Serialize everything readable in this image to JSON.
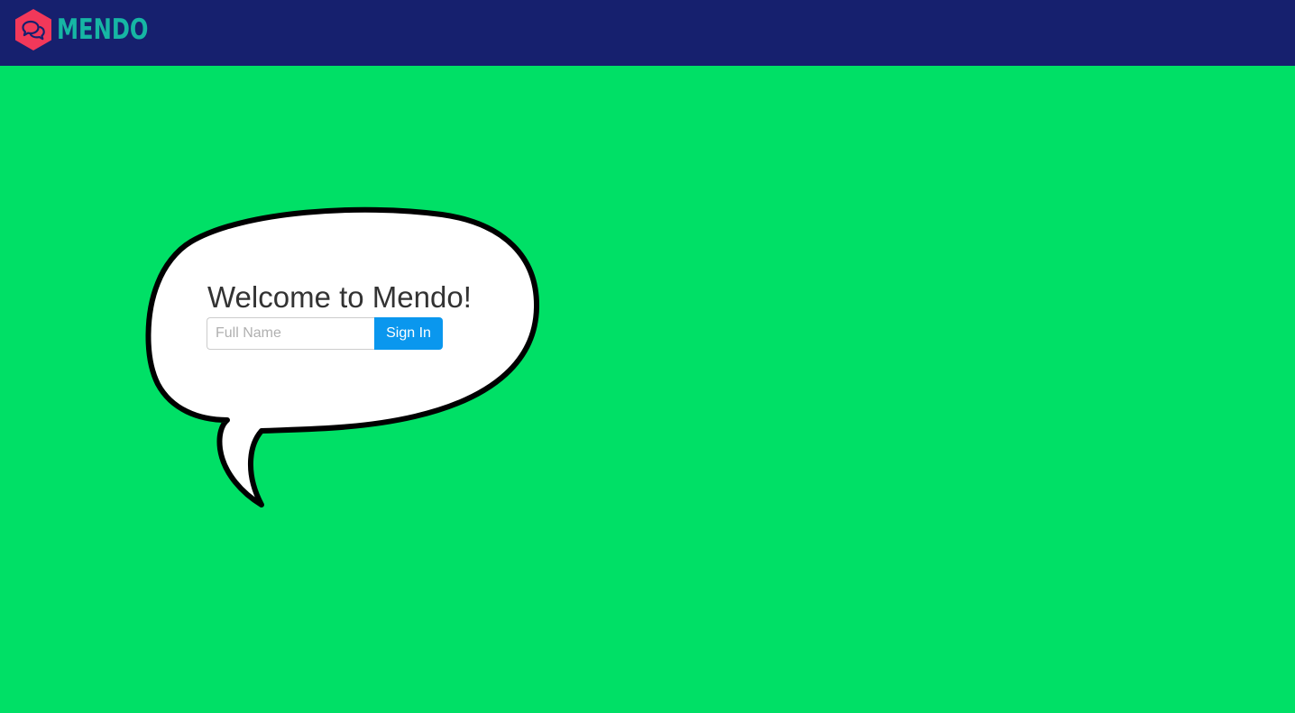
{
  "navbar": {
    "brand_name": "MENDO",
    "logo_icon": "chat-bubbles-hexagon-icon",
    "background_color": "#16206e",
    "brand_color": "#16b6a4",
    "logo_color": "#f2385a"
  },
  "hero": {
    "background_color": "#00e066",
    "bubble_icon": "speech-bubble-icon",
    "title": "Welcome to Mendo!",
    "name_input": {
      "placeholder": "Full Name",
      "value": ""
    },
    "signin_label": "Sign In",
    "button_color": "#0a97ee"
  }
}
